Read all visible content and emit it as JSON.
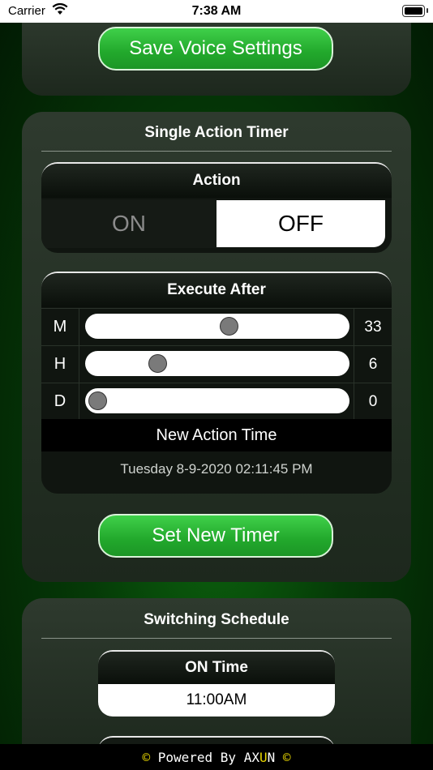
{
  "status": {
    "carrier": "Carrier",
    "time": "7:38 AM"
  },
  "voice": {
    "save_label": "Save Voice Settings"
  },
  "timer": {
    "title": "Single Action Timer",
    "action": {
      "header": "Action",
      "on_label": "ON",
      "off_label": "OFF",
      "selected": "OFF"
    },
    "execute": {
      "header": "Execute After",
      "rows": [
        {
          "label": "M",
          "value": "33",
          "fraction": 0.55
        },
        {
          "label": "H",
          "value": "6",
          "fraction": 0.25
        },
        {
          "label": "D",
          "value": "0",
          "fraction": 0.0
        }
      ],
      "new_time_label": "New Action Time",
      "new_time_value": "Tuesday 8-9-2020 02:11:45 PM"
    },
    "set_label": "Set New Timer"
  },
  "schedule": {
    "title": "Switching Schedule",
    "on_time_header": "ON Time",
    "on_time_value": "11:00AM"
  },
  "footer": {
    "copyright_left": "©",
    "powered": "Powered By",
    "brand_ax": "AX",
    "brand_u": "U",
    "brand_n": "N",
    "copyright_right": "©"
  },
  "colors": {
    "accent": "#22a82c",
    "brand_highlight": "#e9d700"
  }
}
